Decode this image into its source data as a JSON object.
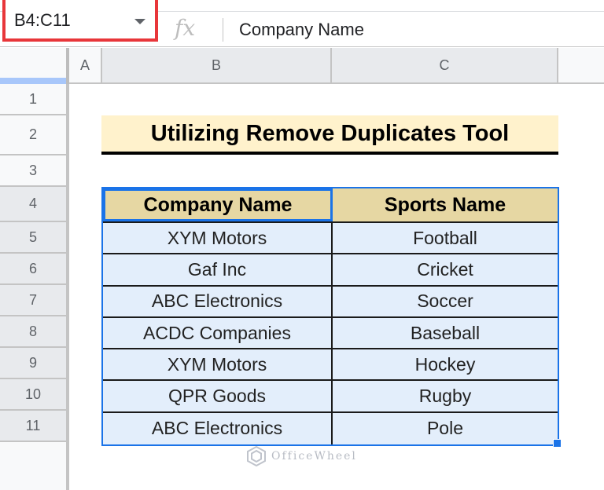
{
  "formula_bar": {
    "name_box": "B4:C11",
    "fx_label": "fx",
    "formula": "Company Name"
  },
  "columns": [
    "A",
    "B",
    "C"
  ],
  "rows": [
    "1",
    "2",
    "3",
    "4",
    "5",
    "6",
    "7",
    "8",
    "9",
    "10",
    "11"
  ],
  "sheet": {
    "title": "Utilizing Remove Duplicates Tool",
    "headers": [
      "Company Name",
      "Sports Name"
    ],
    "data": [
      [
        "XYM Motors",
        "Football"
      ],
      [
        "Gaf Inc",
        "Cricket"
      ],
      [
        "ABC Electronics",
        "Soccer"
      ],
      [
        "ACDC Companies",
        "Baseball"
      ],
      [
        "XYM Motors",
        "Hockey"
      ],
      [
        "QPR Goods",
        "Rugby"
      ],
      [
        "ABC Electronics",
        "Pole"
      ]
    ]
  },
  "watermark": "OfficeWheel",
  "colors": {
    "selection": "#1a73e8",
    "highlight_box": "#e8363a",
    "title_fill": "#fff2cc",
    "header_fill": "#e6d7a3",
    "data_fill": "#e3eefb"
  }
}
